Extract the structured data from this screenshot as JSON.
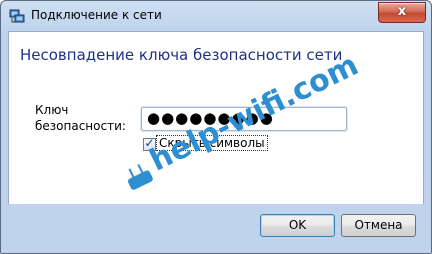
{
  "window": {
    "title": "Подключение к сети",
    "close_label": "x",
    "accent": "#c24a33"
  },
  "dialog": {
    "heading": "Несовпадение ключа безопасности сети",
    "field_label": "Ключ\nбезопасности:",
    "password_value": "●●●●●●●●●",
    "show_chars_label": "Скрыть символы",
    "show_chars_checked": true,
    "checkbox_mark": "✓"
  },
  "watermark": {
    "text": "help-wifi.com",
    "color": "#2d8fd1"
  },
  "buttons": {
    "ok_label": "OK",
    "cancel_label": "Отмена"
  }
}
